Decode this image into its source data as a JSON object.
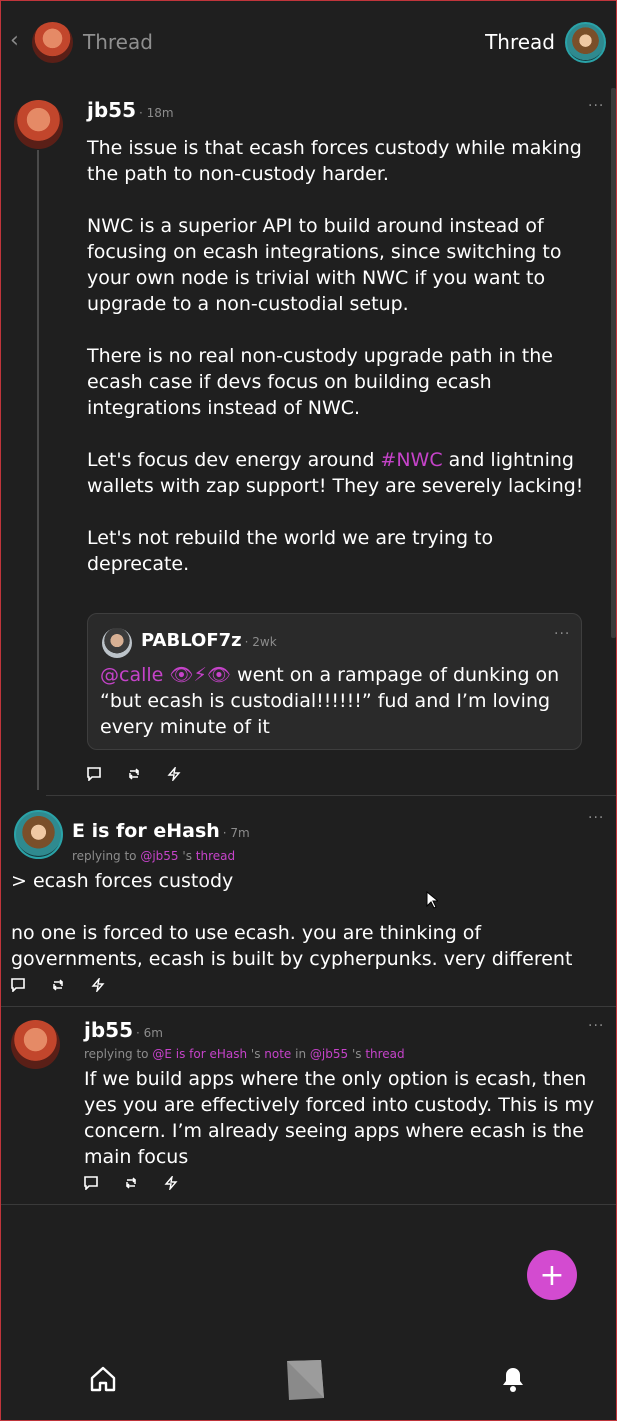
{
  "header": {
    "back_icon": "chevron-left-icon",
    "title_left": "Thread",
    "title_right": "Thread"
  },
  "post1": {
    "author": "jb55",
    "time": "18m",
    "paragraphs": [
      "The issue is that ecash forces custody while making the path to non-custody harder.",
      "NWC is a superior API to build around instead of focusing on ecash integrations, since switching to your own node is trivial with NWC if you want to upgrade to a non-custodial setup.",
      "There is no real non-custody upgrade path in the ecash case if devs focus on building ecash integrations instead of NWC."
    ],
    "p4_before": "Let's focus dev energy around ",
    "p4_hashtag": "#NWC",
    "p4_after": " and lightning wallets with zap support! They are severely lacking!",
    "p5": "Let's not rebuild the world we are trying to deprecate.",
    "quote": {
      "author": "PABLOF7z",
      "time": "2wk",
      "mention": "@calle",
      "emoji": "👁⚡👁",
      "text": " went on a rampage of dunking on “but ecash is custodial!!!!!!” fud and I’m loving every minute of it"
    }
  },
  "post2": {
    "author": "E is for eHash",
    "time": "7m",
    "replying_prefix": "replying to ",
    "replying_user": "@jb55",
    "replying_mid": " 's ",
    "replying_link": "thread",
    "line1": "> ecash forces custody",
    "line2": "no one is forced to use ecash. you are thinking of governments, ecash is built by cypherpunks. very different"
  },
  "post3": {
    "author": "jb55",
    "time": "6m",
    "replying_prefix": "replying to ",
    "replying_user": "@E is for eHash",
    "replying_mid": " 's ",
    "replying_note": "note",
    "replying_in": " in ",
    "replying_user2": "@jb55",
    "replying_mid2": " 's ",
    "replying_link": "thread",
    "text": "If we build apps where the only option is ecash, then yes you are effectively forced into custody. This is my concern. I’m already seeing apps where ecash is the main focus"
  },
  "fab": {
    "label": "+"
  },
  "more_label": "···",
  "colors": {
    "accent": "#c543c9",
    "fab": "#d34bd0",
    "background": "#1f1f1f"
  }
}
